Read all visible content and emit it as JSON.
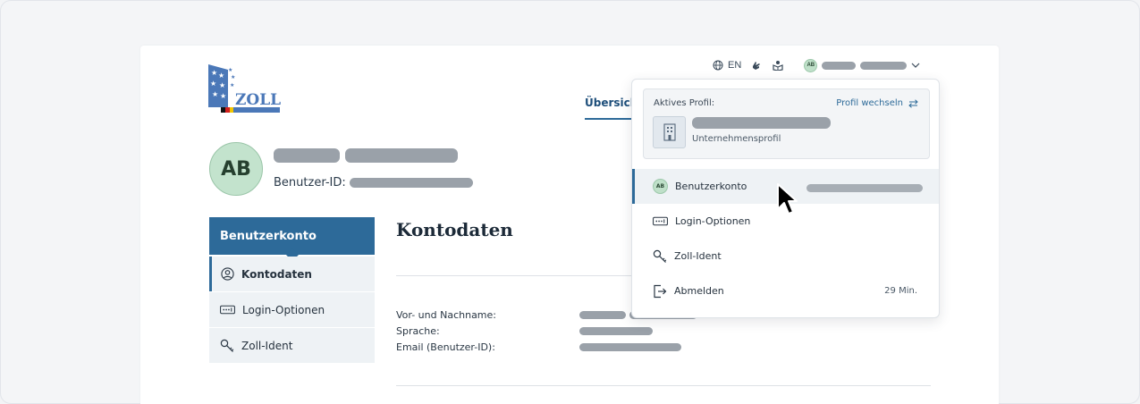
{
  "header": {
    "logo_text": "ZOLL",
    "language": "EN",
    "nav_tab": "Übersicht"
  },
  "profile": {
    "initials": "AB",
    "user_id_label": "Benutzer-ID:"
  },
  "sidebar": {
    "title": "Benutzerkonto",
    "items": [
      {
        "label": "Kontodaten",
        "active": true,
        "icon": "user-circle-icon"
      },
      {
        "label": "Login-Optionen",
        "active": false,
        "icon": "password-field-icon"
      },
      {
        "label": "Zoll-Ident",
        "active": false,
        "icon": "key-icon"
      }
    ]
  },
  "content": {
    "title": "Kontodaten",
    "fields": [
      {
        "label": "Vor- und Nachname:"
      },
      {
        "label": "Sprache:"
      },
      {
        "label": "Email (Benutzer-ID):"
      }
    ]
  },
  "dropdown": {
    "active_profile_label": "Aktives Profil:",
    "switch_profile": "Profil wechseln",
    "profile_type": "Unternehmensprofil",
    "items": [
      {
        "label": "Benutzerkonto",
        "icon": "avatar-icon",
        "initials": "AB"
      },
      {
        "label": "Login-Optionen",
        "icon": "password-field-icon"
      },
      {
        "label": "Zoll-Ident",
        "icon": "key-icon"
      },
      {
        "label": "Abmelden",
        "icon": "logout-icon",
        "meta": "29 Min."
      }
    ]
  },
  "colors": {
    "primary": "#2d6a99",
    "avatar_green": "#c3e3cd",
    "placeholder_bar": "#9aa1a9"
  }
}
